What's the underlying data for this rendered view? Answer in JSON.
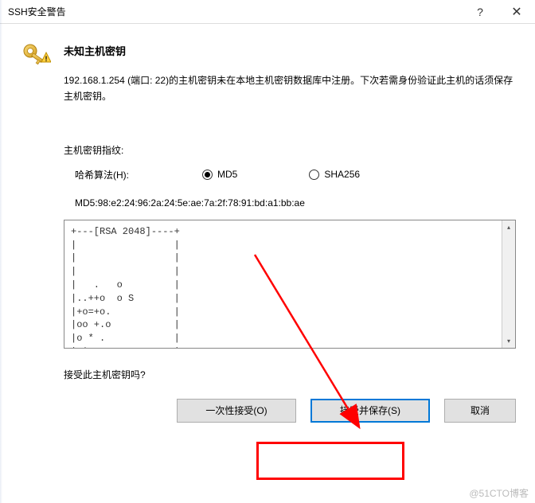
{
  "window": {
    "title": "SSH安全警告",
    "help_symbol": "?",
    "close_symbol": "✕"
  },
  "main": {
    "heading": "未知主机密钥",
    "description": "192.168.1.254 (端口: 22)的主机密钥未在本地主机密钥数据库中注册。下次若需身份验证此主机的话须保存主机密钥。",
    "fingerprint_label": "主机密钥指纹:",
    "hash_label": "哈希算法(H):",
    "radio_md5": "MD5",
    "radio_sha256": "SHA256",
    "fingerprint_value": "MD5:98:e2:24:96:2a:24:5e:ae:7a:2f:78:91:bd:a1:bb:ae",
    "ascii_art": "+---[RSA 2048]----+\n|                 |\n|                 |\n|                 |\n|   .   o         |\n|..++o  o S       |\n|+o=+o.           |\n|oo +.o           |\n|o * .            |\n|E*+=.            |",
    "question": "接受此主机密钥吗?"
  },
  "buttons": {
    "accept_once": "一次性接受(O)",
    "accept_save": "接受并保存(S)",
    "cancel": "取消"
  },
  "watermark": "@51CTO博客"
}
